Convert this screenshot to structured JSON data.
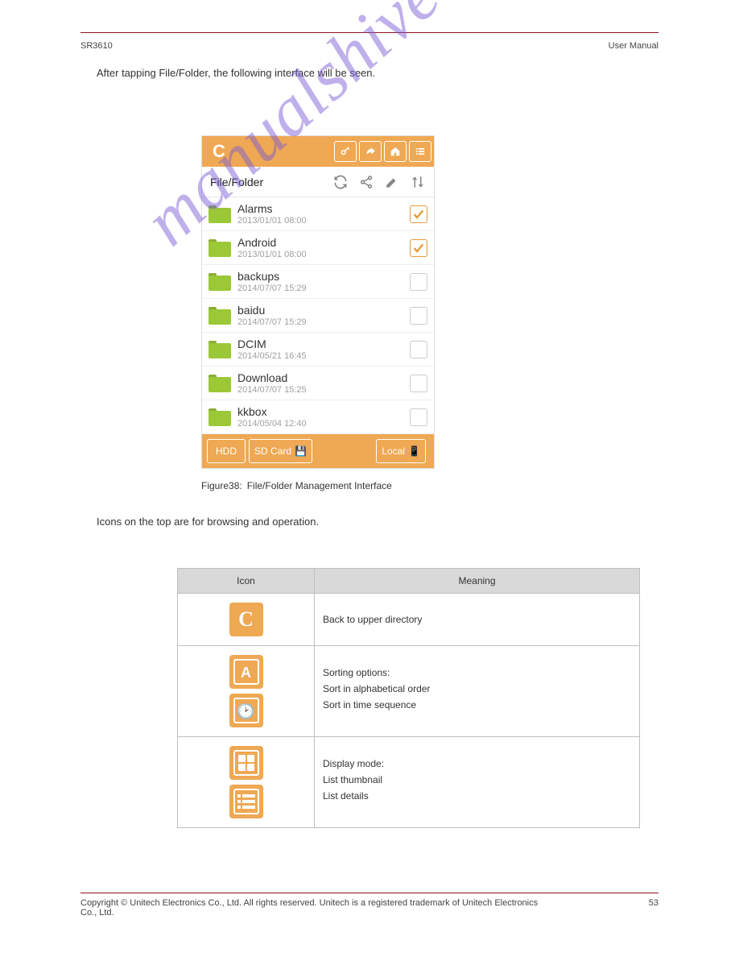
{
  "header": {
    "product": "SR3610",
    "doc": "User Manual"
  },
  "intro": "After tapping File/Folder, the following interface will be seen.",
  "screenshot": {
    "title_bar": {
      "logo": "C"
    },
    "toolbar_label": "File/Folder",
    "rows": [
      {
        "name": "Alarms",
        "date": "2013/01/01 08:00",
        "checked": true
      },
      {
        "name": "Android",
        "date": "2013/01/01 08:00",
        "checked": true
      },
      {
        "name": "backups",
        "date": "2014/07/07 15:29",
        "checked": false
      },
      {
        "name": "baidu",
        "date": "2014/07/07 15:29",
        "checked": false
      },
      {
        "name": "DCIM",
        "date": "2014/05/21 16:45",
        "checked": false
      },
      {
        "name": "Download",
        "date": "2014/07/07 15:25",
        "checked": false
      },
      {
        "name": "kkbox",
        "date": "2014/05/04 12:40",
        "checked": false
      }
    ],
    "bottom_buttons": {
      "hdd": "HDD",
      "sdcard": "SD Card",
      "local": "Local"
    }
  },
  "caption": {
    "figno": "Figure38:",
    "text": "File/Folder Management Interface"
  },
  "table_intro": "Icons on the top are for browsing and operation.",
  "table_header": {
    "icon": "Icon",
    "meaning": "Meaning"
  },
  "table_rows": {
    "back": "Back to upper directory",
    "sort_head": "Sorting options:",
    "sort_alpha": "Sort in alphabetical order",
    "sort_time": "Sort in time sequence",
    "display_head": "Display mode:",
    "display_thumb": "List thumbnail",
    "display_detail": "List details"
  },
  "footer": {
    "copyright": "Copyright © Unitech Electronics Co., Ltd. All rights reserved. Unitech is a registered trademark of Unitech Electronics Co., Ltd.",
    "page": "53"
  },
  "watermark": "manualshive.com"
}
